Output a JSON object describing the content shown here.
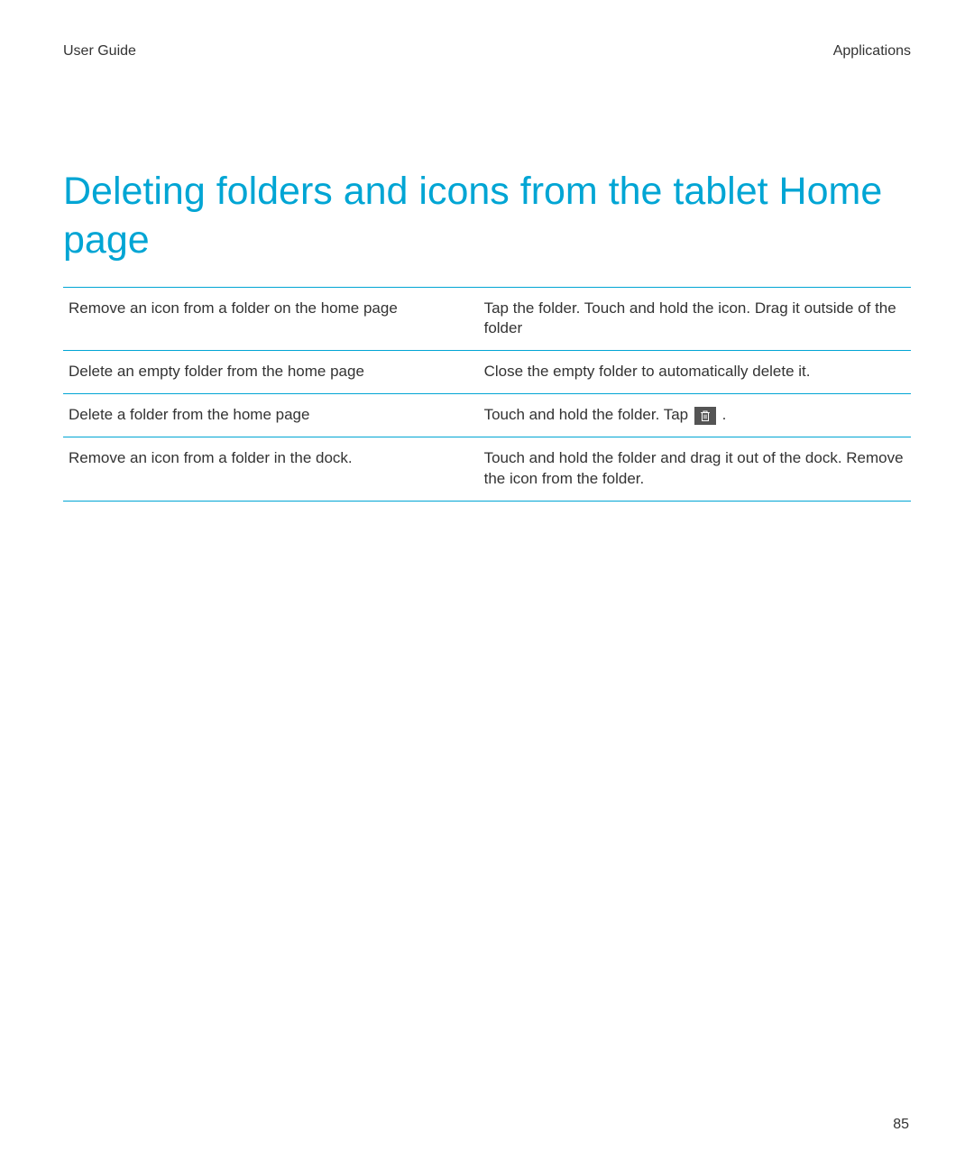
{
  "header": {
    "left": "User Guide",
    "right": "Applications"
  },
  "title": "Deleting folders and icons from the tablet Home page",
  "rows": [
    {
      "left": "Remove an icon from a folder on the home page",
      "right": "Tap the folder. Touch and hold the icon. Drag it outside of the folder"
    },
    {
      "left": "Delete an empty folder from the home page",
      "right": "Close the empty folder to automatically delete it."
    },
    {
      "left": "Delete a folder from the home page",
      "right_before": "Touch and hold the folder. Tap ",
      "right_after": " .",
      "has_icon": true
    },
    {
      "left": "Remove an icon from a folder in the dock.",
      "right": "Touch and hold the folder and drag it out of the dock. Remove the icon from the folder."
    }
  ],
  "page_number": "85"
}
